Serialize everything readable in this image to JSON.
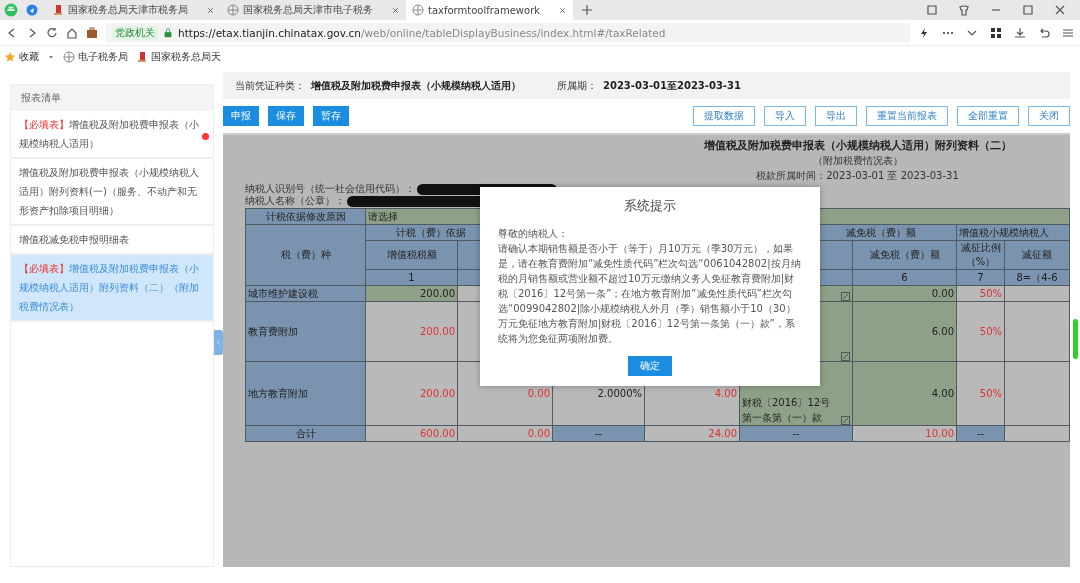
{
  "browser": {
    "tabs": [
      {
        "title": "国家税务总局天津市税务局",
        "selected": false
      },
      {
        "title": "国家税务总局天津市电子税务",
        "selected": false
      },
      {
        "title": "taxformtoolframework",
        "selected": true
      }
    ],
    "badge": "党政机关",
    "url_host": "https://etax.tianjin.chinatax.gov.cn",
    "url_path": "/web/online/tableDisplayBusiness/index.html#/taxRelated",
    "bookmarks": [
      "收藏",
      "电子税务局",
      "国家税务总局天"
    ]
  },
  "sidebar": {
    "title": "报表清单",
    "items": [
      {
        "tag": "【必填表】",
        "title": "增值税及附加税费申报表（小规模纳税人适用）",
        "alert": true,
        "selected": false
      },
      {
        "title": "增值税及附加税费申报表（小规模纳税人适用）附列资料(一)（服务、不动产和无形资产扣除项目明细）",
        "alert": false,
        "selected": false
      },
      {
        "title": "增值税减免税申报明细表",
        "alert": false,
        "selected": false
      },
      {
        "tag": "【必填表】",
        "title": "增值税及附加税费申报表（小规模纳税人适用）附列资料（二）（附加税费情况表）",
        "alert": false,
        "selected": true
      }
    ]
  },
  "header": {
    "type_label": "当前凭证种类：",
    "type_value": "增值税及附加税费申报表（小规模纳税人适用）",
    "period_label": "所属期：",
    "period_value": "2023-03-01至2023-03-31"
  },
  "primary_buttons": [
    "申报",
    "保存",
    "暂存"
  ],
  "secondary_buttons": [
    "提取数据",
    "导入",
    "导出",
    "重置当前报表",
    "全部重置",
    "关闭"
  ],
  "form": {
    "title": "增值税及附加税费申报表（小规模纳税人适用）附列资料（二）",
    "subtitle": "（附加税费情况表）",
    "period": "税款所属时间：2023-03-01 至 2023-03-31",
    "taxpayer_id_label": "纳税人识别号（统一社会信用代码）：",
    "taxpayer_name_label": "纳税人名称（公章）：",
    "table": {
      "reason_label": "计税依据修改原因",
      "reason_value": "请选择",
      "tax_type_header": "税（费）种",
      "group_headers": [
        "计税（费）依据",
        "减免税（费）额",
        "增值税小规模纳税人"
      ],
      "column_headers": {
        "column_2": "增值税税额",
        "column_7": "减免税（费）额",
        "column_8": "减征比例（%）",
        "column_9": "减征额"
      },
      "column_numbers": {
        "column_2": "1",
        "column_7": "6",
        "column_8": "7",
        "column_9": "8=（4-6"
      },
      "rows": [
        {
          "name": "城市维护建设税",
          "cells": {
            "column_2": {
              "text": "200.00",
              "red": false,
              "editable": true
            },
            "column_6": {
              "picker": true,
              "editable": true
            },
            "column_7": {
              "text": "0.00",
              "red": false,
              "editable": true
            },
            "column_8": {
              "text": "50%",
              "red": true,
              "editable": false
            }
          }
        },
        {
          "name": "教育费附加",
          "cells": {
            "column_2": {
              "text": "200.00",
              "red": true,
              "editable": false
            },
            "column_6": {
              "picker": true,
              "editable": true
            },
            "column_7": {
              "text": "6.00",
              "red": false,
              "editable": true
            },
            "column_8": {
              "text": "50%",
              "red": true,
              "editable": false
            }
          }
        },
        {
          "name": "地方教育附加",
          "cells": {
            "column_2": {
              "text": "200.00",
              "red": true,
              "editable": false
            },
            "column_3": {
              "text": "0.00",
              "red": true,
              "editable": false
            },
            "column_4": {
              "text": "2.0000%",
              "red": false,
              "editable": false
            },
            "column_5": {
              "text": "4.00",
              "red": true,
              "editable": false
            },
            "column_6": {
              "picker": true,
              "editable": true,
              "text": "财税〔2016〕12号第一条第（一）款"
            },
            "column_7": {
              "text": "4.00",
              "red": false,
              "editable": true
            },
            "column_8": {
              "text": "50%",
              "red": true,
              "editable": false
            }
          }
        },
        {
          "name": "合计",
          "cells": {
            "column_2": {
              "text": "600.00",
              "red": true,
              "editable": false
            },
            "column_3": {
              "text": "0.00",
              "red": true,
              "editable": false
            },
            "column_4": {
              "text": "--",
              "locked": true
            },
            "column_5": {
              "text": "24.00",
              "red": true,
              "editable": false
            },
            "column_6": {
              "text": "--",
              "locked": true
            },
            "column_7": {
              "text": "10.00",
              "red": true,
              "editable": false
            },
            "column_8": {
              "text": "--",
              "locked": true
            }
          }
        }
      ]
    }
  },
  "dialog": {
    "title": "系统提示",
    "greeting": "尊敬的纳税人：",
    "message": "请确认本期销售额是否小于（等于）月10万元（季30万元），如果是，请在教育费附加“减免性质代码”栏次勾选“0061042802|按月纳税的月销售额或营业额不超过10万元缴纳义务人免征教育费附加|财税〔2016〕12号第一条”；在地方教育附加“减免性质代码”栏次勾选“0099042802|除小规模纳税人外月（季）销售额小于10（30）万元免征地方教育附加|财税〔2016〕12号第一条第（一）款”，系统将为您免征两项附加费。",
    "button": "确定"
  }
}
